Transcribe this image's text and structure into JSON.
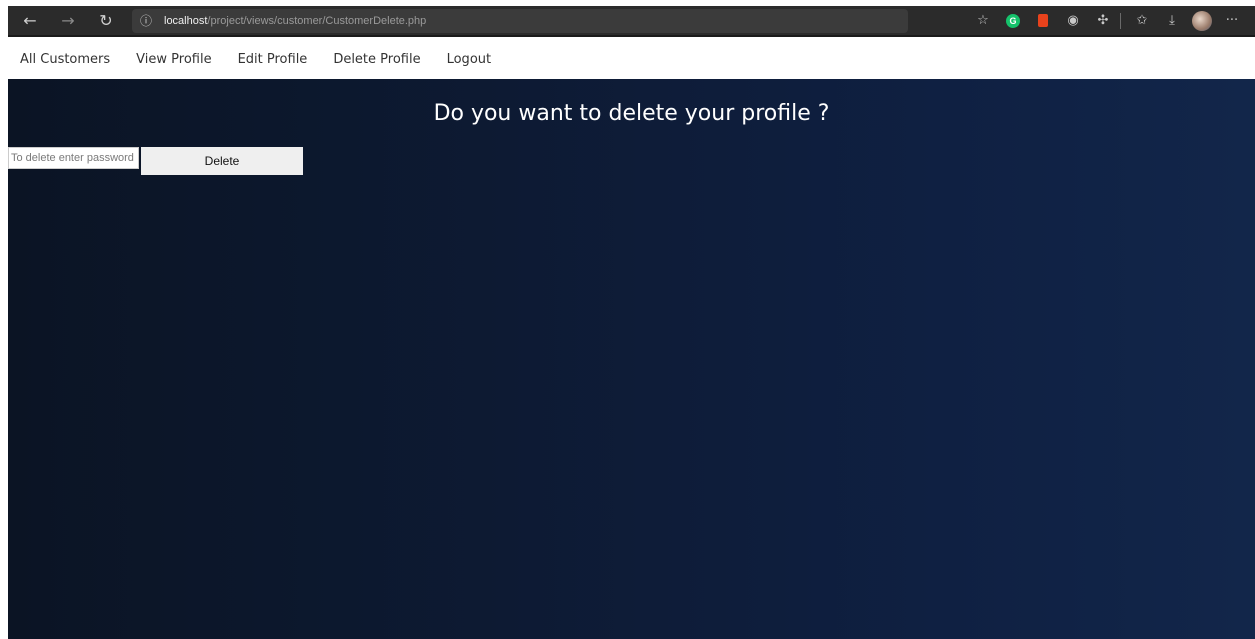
{
  "browser": {
    "url_host": "localhost",
    "url_path": "/project/views/customer/CustomerDelete.php",
    "icons": [
      "back-arrow-icon",
      "forward-arrow-icon",
      "reload-icon",
      "info-icon",
      "add-favorite-icon",
      "grammarly-icon",
      "office-icon",
      "extension-icon",
      "puzzle-icon",
      "favorites-icon",
      "download-icon",
      "profile-avatar",
      "more-icon"
    ]
  },
  "nav": {
    "items": [
      {
        "label": "All Customers"
      },
      {
        "label": "View Profile"
      },
      {
        "label": "Edit Profile"
      },
      {
        "label": "Delete Profile"
      },
      {
        "label": "Logout"
      }
    ]
  },
  "main": {
    "title": "Do you want to delete your profile ?",
    "password_placeholder": "To delete enter password",
    "delete_label": "Delete"
  }
}
